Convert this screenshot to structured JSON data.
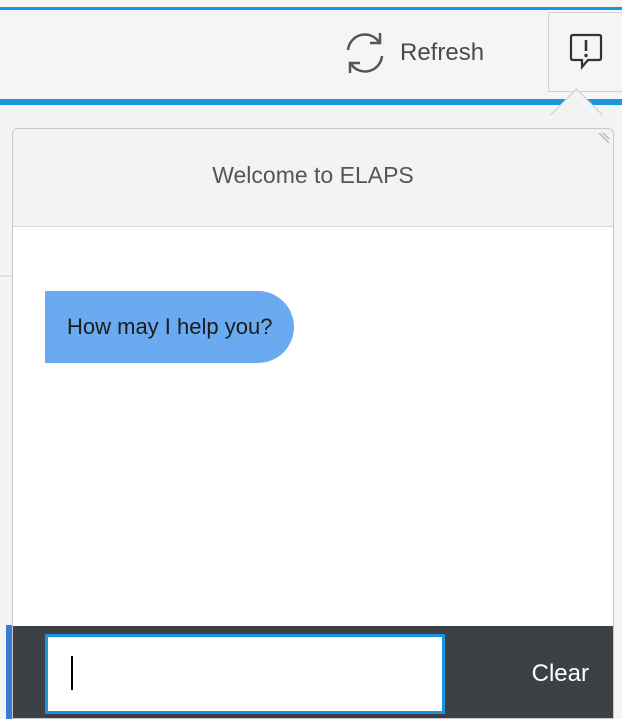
{
  "toolbar": {
    "refresh_label": "Refresh",
    "refresh_icon": "refresh-icon",
    "alert_icon": "alert-message-icon"
  },
  "chat": {
    "title": "Welcome to ELAPS",
    "messages": [
      {
        "sender": "bot",
        "text": "How may I help you?"
      }
    ],
    "input": {
      "value": "",
      "placeholder": ""
    },
    "clear_label": "Clear"
  },
  "colors": {
    "accent": "#1a96e0",
    "bot_bubble": "#6aaaf0",
    "footer": "#3d4145",
    "header": "#f3f3f3"
  }
}
